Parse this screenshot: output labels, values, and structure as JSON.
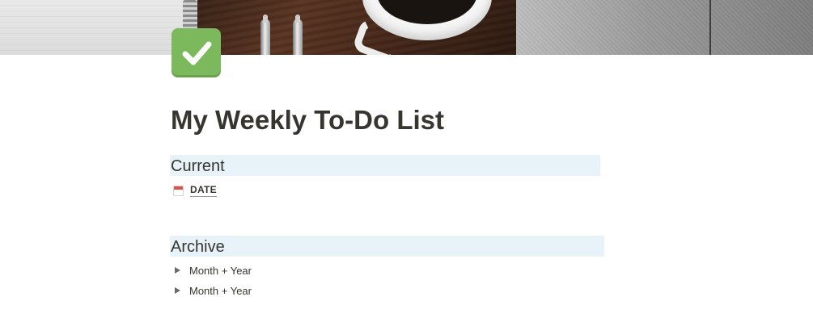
{
  "page": {
    "title": "My Weekly To-Do List",
    "icon": "check-mark-button-icon",
    "accent_color": "#7cb85c",
    "heading_background": "#e7f3f8"
  },
  "cover": {
    "description_icon": "cover-image"
  },
  "sections": {
    "current": {
      "heading": "Current",
      "date_property": {
        "icon": "calendar-icon",
        "label": "DATE"
      }
    },
    "archive": {
      "heading": "Archive",
      "toggles": [
        {
          "label": "Month + Year",
          "icon": "toggle-triangle-icon"
        },
        {
          "label": "Month + Year",
          "icon": "toggle-triangle-icon"
        }
      ]
    }
  }
}
